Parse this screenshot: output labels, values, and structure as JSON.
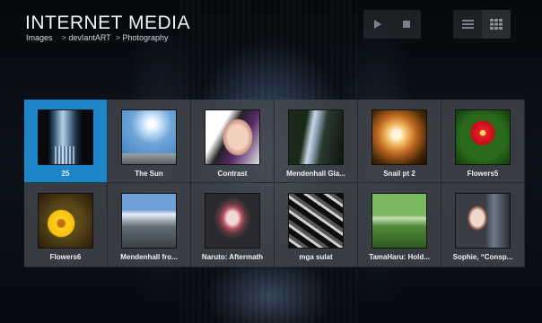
{
  "header": {
    "title": "INTERNET MEDIA",
    "breadcrumb": [
      "Images",
      "devIantART",
      "Photography"
    ],
    "separator": ">"
  },
  "toolbar": {
    "playback": [
      {
        "icon": "play-icon"
      },
      {
        "icon": "stop-icon"
      }
    ],
    "views": [
      {
        "icon": "list-view-icon"
      },
      {
        "icon": "grid-view-icon",
        "active": true
      }
    ]
  },
  "colors": {
    "selected": "#1e86c8",
    "title": "#f2f4f6"
  },
  "gallery": {
    "items": [
      {
        "caption": "25",
        "selected": true,
        "thumb": "t-25"
      },
      {
        "caption": "The Sun",
        "thumb": "t-sun"
      },
      {
        "caption": "Contrast",
        "thumb": "t-contrast"
      },
      {
        "caption": "Mendenhall Gla...",
        "thumb": "t-glacier"
      },
      {
        "caption": "Snail pt 2",
        "thumb": "t-snail"
      },
      {
        "caption": "Flowers5",
        "thumb": "t-flowers5"
      },
      {
        "caption": "Flowers6",
        "thumb": "t-flowers6"
      },
      {
        "caption": "Mendenhall fro...",
        "thumb": "t-mendenhall2"
      },
      {
        "caption": "Naruto: Aftermath",
        "thumb": "t-naruto"
      },
      {
        "caption": "mga sulat",
        "thumb": "t-mga"
      },
      {
        "caption": "TamaHaru: Hold...",
        "thumb": "t-tama"
      },
      {
        "caption": "Sophie, “Consp...",
        "thumb": "t-sophie"
      }
    ]
  }
}
